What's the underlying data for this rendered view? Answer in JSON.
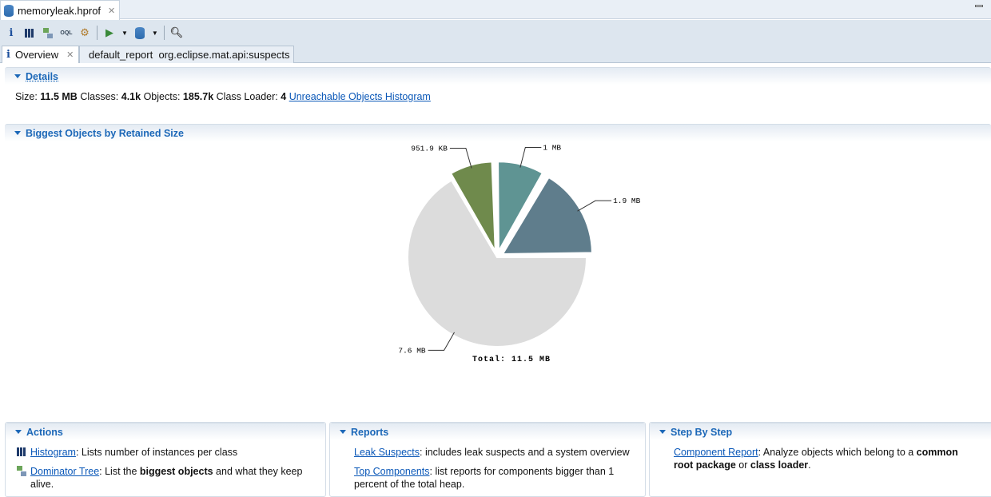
{
  "file_tab": {
    "title": "memoryleak.hprof"
  },
  "toolbar": {
    "icons": [
      "info-icon",
      "histogram-icon",
      "dominator-tree-icon",
      "oql-icon",
      "heap-dump-overview-icon",
      "run-report-icon",
      "query-browser-icon",
      "search-icon"
    ]
  },
  "editor_tabs": [
    {
      "label": "Overview"
    },
    {
      "label": "default_report  org.eclipse.mat.api:suspects"
    }
  ],
  "details": {
    "title": "Details",
    "size_label": "Size:",
    "size": "11.5 MB",
    "classes_label": "Classes:",
    "classes": "4.1k",
    "objects_label": "Objects:",
    "objects": "185.7k",
    "loader_label": "Class Loader:",
    "loader": "4",
    "unreachable_link": "Unreachable Objects Histogram"
  },
  "biggest": {
    "title": "Biggest Objects by Retained Size"
  },
  "chart_data": {
    "type": "pie",
    "title": "Biggest Objects by Retained Size",
    "total_label": "Total: 11.5 MB",
    "slices": [
      {
        "label": "1.9 MB",
        "value_mb": 1.9,
        "color": "#5f7d8c"
      },
      {
        "label": "1 MB",
        "value_mb": 1.0,
        "color": "#5f9493"
      },
      {
        "label": "951.9 KB",
        "value_mb": 0.93,
        "color": "#6f8a4c"
      },
      {
        "label": "7.6 MB",
        "value_mb": 7.6,
        "color": "#dcdcdc"
      }
    ]
  },
  "actions": {
    "title": "Actions",
    "items": [
      {
        "link": "Histogram",
        "text": ": Lists number of instances per class"
      },
      {
        "link": "Dominator Tree",
        "text1": ": List the ",
        "bold": "biggest objects",
        "text2": " and what they keep",
        "text3": "alive."
      }
    ]
  },
  "reports": {
    "title": "Reports",
    "items": [
      {
        "link": "Leak Suspects",
        "text": ": includes leak suspects and a system overview"
      },
      {
        "link": "Top Components",
        "text": ": list reports for components bigger than 1",
        "text2": "percent of the total heap."
      }
    ]
  },
  "steps": {
    "title": "Step By Step",
    "items": [
      {
        "link": "Component Report",
        "text1": ": Analyze objects which belong to a ",
        "bold1": "common",
        "bold2": "root package",
        "text2": " or ",
        "bold3": "class loader",
        "text3": "."
      }
    ]
  }
}
